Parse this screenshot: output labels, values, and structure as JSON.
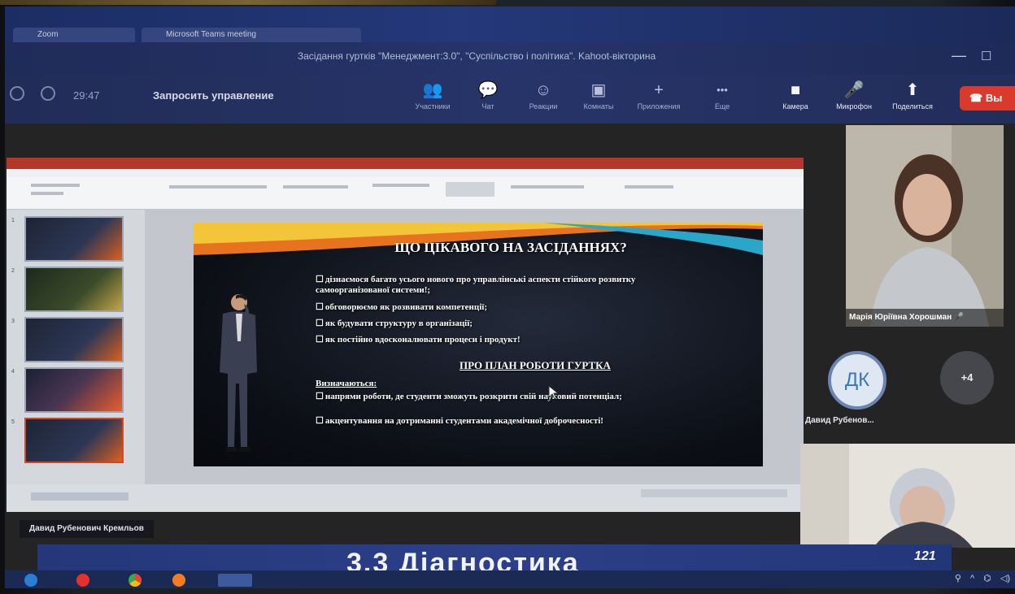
{
  "browser": {
    "tabs": [
      {
        "label": "Zoom"
      },
      {
        "label": "Microsoft Teams meeting"
      }
    ]
  },
  "window": {
    "title": "Засідання гуртків \"Менеджмент:3.0\", \"Суспільство і політика\". Kahoot-вікторина",
    "minimize_icon": "minimize-icon",
    "maximize_icon": "maximize-icon"
  },
  "toolbar": {
    "timer": "29:47",
    "request_control": "Запросить управление",
    "items": [
      {
        "label": "Участники",
        "icon": "participants-icon",
        "glyph": "👥"
      },
      {
        "label": "Чат",
        "icon": "chat-icon",
        "glyph": "💬"
      },
      {
        "label": "Реакции",
        "icon": "reactions-icon",
        "glyph": "☺"
      },
      {
        "label": "Комнаты",
        "icon": "rooms-icon",
        "glyph": "▣"
      },
      {
        "label": "Приложения",
        "icon": "apps-icon",
        "glyph": "+"
      },
      {
        "label": "Еще",
        "icon": "more-icon",
        "glyph": "•••"
      },
      {
        "label": "Камера",
        "icon": "camera-icon",
        "glyph": "■"
      },
      {
        "label": "Микрофон",
        "icon": "microphone-icon",
        "glyph": "🎤"
      },
      {
        "label": "Поделиться",
        "icon": "share-icon",
        "glyph": "⬆"
      }
    ],
    "leave_label": "Вы"
  },
  "slide": {
    "heading": "ЩО ЦІКАВОГО НА ЗАСІДАННЯХ?",
    "bullets": [
      "дізнаємося багато усього нового про управлінські аспекти стійкого розвитку самоорганізованої системи!;",
      "обговорюємо як розвивати компетенції;",
      "як будувати структуру в організації;",
      "як постійно вдосконалювати процеси і продукт!"
    ],
    "subheading": "ПРО ПЛАН РОБОТИ ГУРТКА",
    "intro": "Визначаються:",
    "plan_items": [
      "напрями роботи, де студенти зможуть розкрити свій науковий потенціал;",
      "акцентування на дотриманні студентами академічної доброчесності!"
    ]
  },
  "presenter": {
    "name": "Давид Рубенович Кремльов"
  },
  "participants": {
    "video_1_name": "Марія Юріївна Хорошман",
    "avatar_initials": "ДК",
    "avatar_name": "Давид Рубенов...",
    "more_count": "+4"
  },
  "document_behind": {
    "heading": "3.3 Діагностика",
    "page_number": "121"
  },
  "colors": {
    "zoom_bar": "#25346a",
    "leave_red": "#d93a2b",
    "ppt_red": "#b3372a",
    "slide_dark": "#0c0f16"
  }
}
